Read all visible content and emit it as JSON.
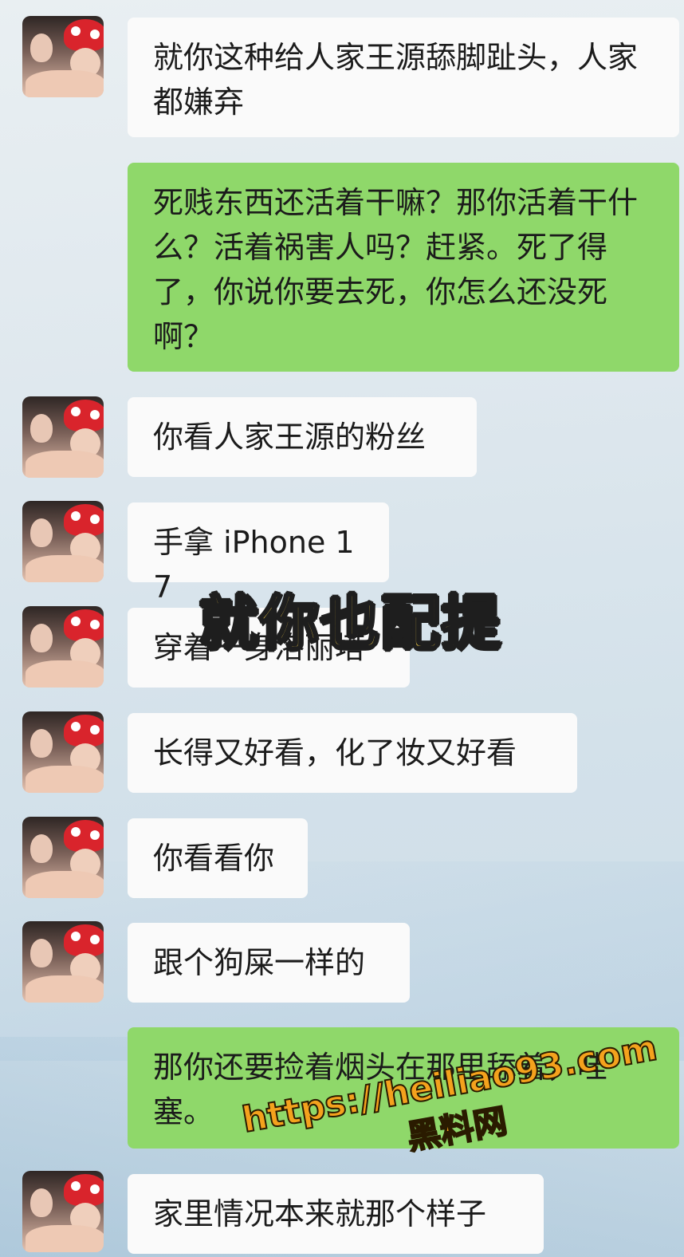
{
  "messages": [
    {
      "side": "left",
      "text": "就你这种给人家王源舔脚趾头，人家都嫌弃"
    },
    {
      "side": "right",
      "text": "死贱东西还活着干嘛？那你活着干什么？活着祸害人吗？赶紧。死了得了，你说你要去死，你怎么还没死啊？"
    },
    {
      "side": "left",
      "text": "你看人家王源的粉丝"
    },
    {
      "side": "left",
      "text": "手拿 iPhone 17"
    },
    {
      "side": "left",
      "text": "穿着一身洛丽塔"
    },
    {
      "side": "left",
      "text": "长得又好看，化了妆又好看"
    },
    {
      "side": "left",
      "text": "你看看你"
    },
    {
      "side": "left",
      "text": "跟个狗屎一样的"
    },
    {
      "side": "right",
      "text": "那你还要捡着烟头在那里舔着，哇塞。"
    },
    {
      "side": "left",
      "text": "家里情况本来就那个样子"
    }
  ],
  "caption": "就你也配提",
  "watermark": {
    "url": "https://heiliao93.com",
    "site": "黑料网"
  },
  "colors": {
    "incoming_bubble": "#fafafa",
    "outgoing_bubble": "#8fd86a",
    "caption_fill": "#ffd84a",
    "watermark_fill": "#f4a21d"
  }
}
